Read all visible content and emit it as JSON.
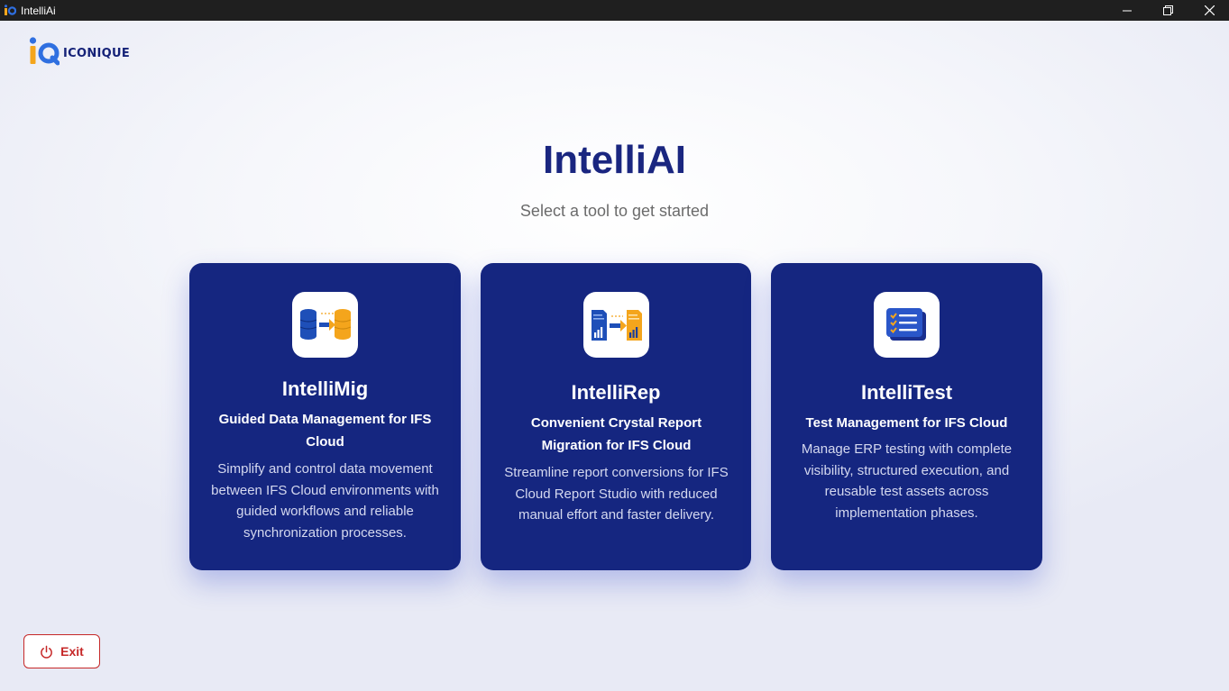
{
  "window": {
    "title": "IntelliAi"
  },
  "logo": {
    "text": "ICONIQUE"
  },
  "hero": {
    "title": "IntelliAI",
    "subtitle": "Select a tool to get started"
  },
  "cards": [
    {
      "title": "IntelliMig",
      "subtitle": "Guided Data Management for IFS Cloud",
      "description": "Simplify and control data movement between IFS Cloud environments with guided workflows and reliable synchronization processes.",
      "icon": "database-migration-icon"
    },
    {
      "title": "IntelliRep",
      "subtitle": "Convenient Crystal Report Migration for IFS Cloud",
      "description": "Streamline report conversions for IFS Cloud Report Studio with reduced manual effort and faster delivery.",
      "icon": "report-migration-icon"
    },
    {
      "title": "IntelliTest",
      "subtitle": "Test Management for IFS Cloud",
      "description": "Manage ERP testing with complete visibility, structured execution, and reusable test assets across implementation phases.",
      "icon": "checklist-icon"
    }
  ],
  "exit": {
    "label": "Exit",
    "icon": "power-icon"
  },
  "colors": {
    "card_bg": "#152680",
    "title": "#1a2680",
    "exit": "#c62828",
    "accent_orange": "#f4a51c"
  }
}
